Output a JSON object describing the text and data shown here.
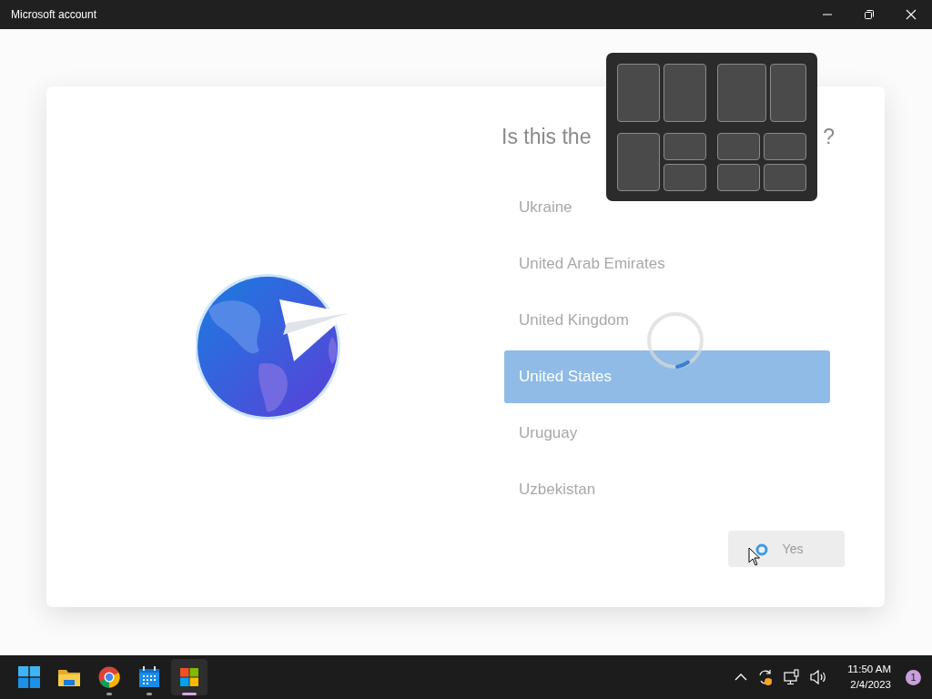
{
  "window": {
    "title": "Microsoft account"
  },
  "heading": {
    "before_cover": "Is this the",
    "after_cover": "?"
  },
  "countries": [
    {
      "name": "Ukraine",
      "selected": false
    },
    {
      "name": "United Arab Emirates",
      "selected": false
    },
    {
      "name": "United Kingdom",
      "selected": false
    },
    {
      "name": "United States",
      "selected": true
    },
    {
      "name": "Uruguay",
      "selected": false
    },
    {
      "name": "Uzbekistan",
      "selected": false
    }
  ],
  "yes_button": {
    "label": "Yes",
    "disabled": true
  },
  "taskbar": {
    "apps": [
      {
        "kind": "start",
        "running": false,
        "selected": false
      },
      {
        "kind": "folder",
        "running": false,
        "selected": false
      },
      {
        "kind": "browser",
        "running": true,
        "selected": false
      },
      {
        "kind": "calendar",
        "running": true,
        "selected": false
      },
      {
        "kind": "store",
        "running": true,
        "selected": true
      }
    ],
    "time": "11:50 AM",
    "date": "2/4/2023",
    "notification_count": "1"
  }
}
